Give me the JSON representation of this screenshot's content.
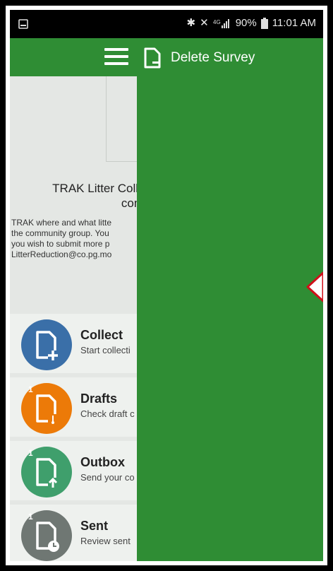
{
  "status_bar": {
    "battery": "90%",
    "time": "11:01 AM"
  },
  "app_bar": {
    "title": "Delete Survey"
  },
  "background": {
    "title_line1": "TRAK Litter Collec",
    "title_line2": "com",
    "description_lines": [
      "TRAK where and what litte",
      "the community group. You",
      "you wish to submit more p",
      "LitterReduction@co.pg.mo"
    ]
  },
  "menu_items": [
    {
      "label": "Collect",
      "subtitle": "Start collecti",
      "color": "#3a6fa8",
      "badge": ""
    },
    {
      "label": "Drafts",
      "subtitle": "Check draft c",
      "color": "#ec7a08",
      "badge": "1"
    },
    {
      "label": "Outbox",
      "subtitle": "Send your co",
      "color": "#3f9f6c",
      "badge": "1"
    },
    {
      "label": "Sent",
      "subtitle": "Review sent",
      "color": "#6f7773",
      "badge": "1"
    }
  ],
  "colors": {
    "app_green": "#2f8d34",
    "arrow_red": "#d0101a"
  }
}
